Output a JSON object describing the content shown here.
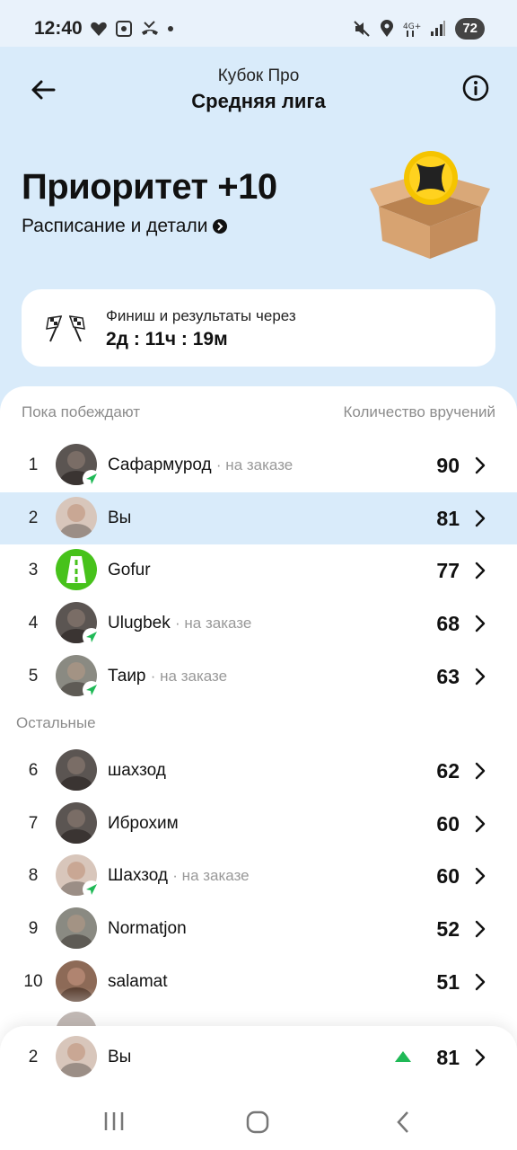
{
  "status_bar": {
    "time": "12:40",
    "battery": "72"
  },
  "header": {
    "subtitle": "Кубок Про",
    "title": "Средняя лига"
  },
  "priority": {
    "title": "Приоритет +10",
    "details_link": "Расписание и детали"
  },
  "finish": {
    "label": "Финиш и результаты через",
    "countdown": "2д : 11ч : 19м"
  },
  "columns": {
    "left": "Пока побеждают",
    "right": "Количество вручений"
  },
  "sections": {
    "others": "Остальные"
  },
  "leaders": [
    {
      "rank": "1",
      "name": "Сафармурод",
      "status": "· на заказе",
      "score": "90",
      "avatar": "photo-dark",
      "on_order": true
    },
    {
      "rank": "2",
      "name": "Вы",
      "status": "",
      "score": "81",
      "avatar": "photo-light",
      "on_order": false,
      "is_me": true
    },
    {
      "rank": "3",
      "name": "Gofur",
      "status": "",
      "score": "77",
      "avatar": "road-icon",
      "on_order": false
    },
    {
      "rank": "4",
      "name": "Ulugbek",
      "status": "· на заказе",
      "score": "68",
      "avatar": "photo-dark",
      "on_order": true
    },
    {
      "rank": "5",
      "name": "Таир",
      "status": "· на заказе",
      "score": "63",
      "avatar": "photo-mid",
      "on_order": true
    }
  ],
  "others": [
    {
      "rank": "6",
      "name": "шахзод",
      "status": "",
      "score": "62",
      "avatar": "photo-dark",
      "on_order": false
    },
    {
      "rank": "7",
      "name": "Иброхим",
      "status": "",
      "score": "60",
      "avatar": "photo-dark",
      "on_order": false
    },
    {
      "rank": "8",
      "name": "Шахзод",
      "status": "· на заказе",
      "score": "60",
      "avatar": "photo-light",
      "on_order": true
    },
    {
      "rank": "9",
      "name": "Normatjon",
      "status": "",
      "score": "52",
      "avatar": "photo-mid",
      "on_order": false
    },
    {
      "rank": "10",
      "name": "salamat",
      "status": "",
      "score": "51",
      "avatar": "photo-warm",
      "on_order": false
    }
  ],
  "me_footer": {
    "rank": "2",
    "name": "Вы",
    "score": "81",
    "trend": "up-arrow-icon"
  },
  "colors": {
    "accent_blue": "#d9ebfa",
    "trend_green": "#1fb956",
    "gofur_green": "#47c21b"
  }
}
